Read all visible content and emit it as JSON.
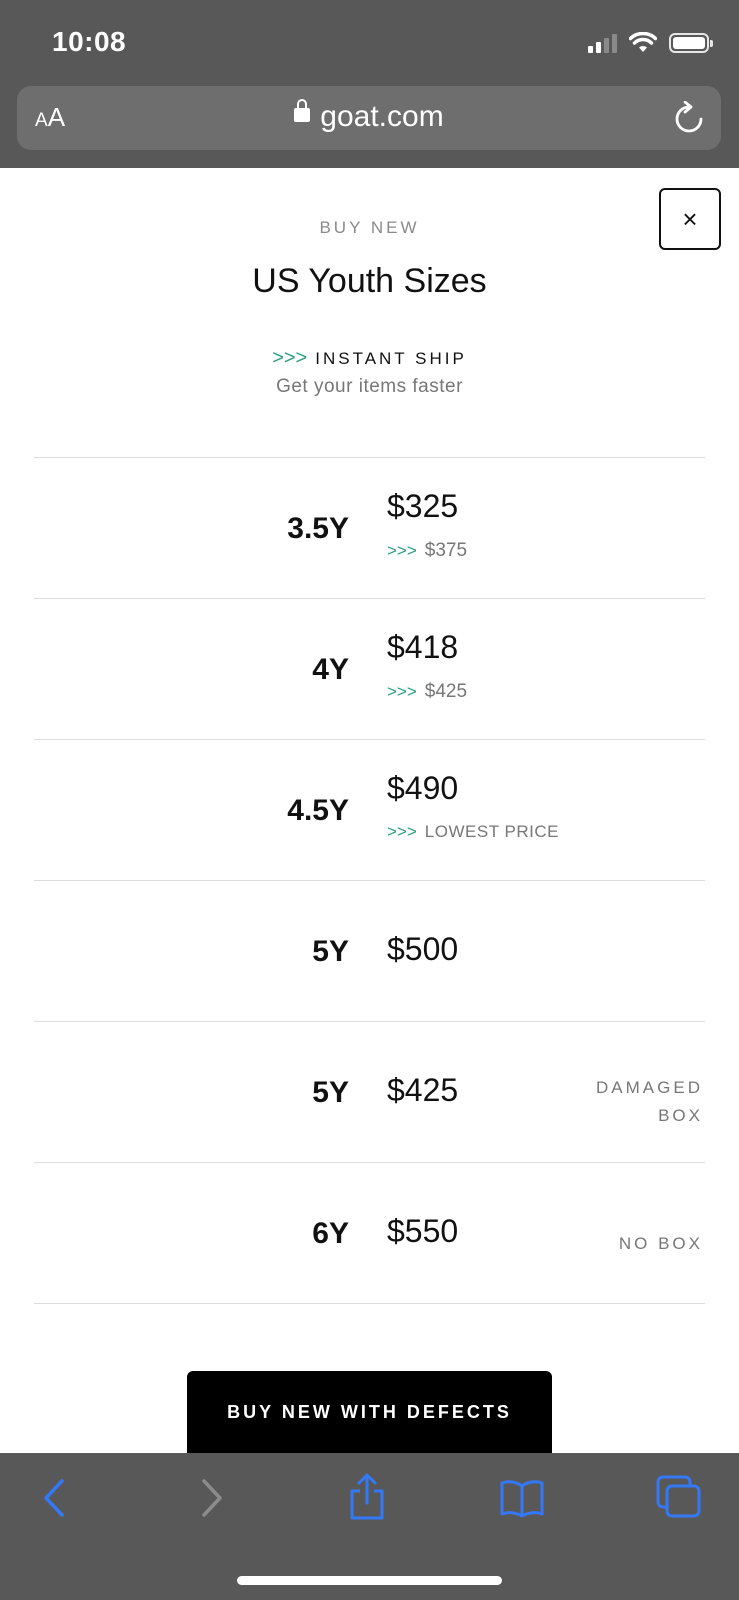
{
  "status_bar": {
    "time": "10:08"
  },
  "browser": {
    "text_size_small": "A",
    "text_size_large": "A",
    "url": "goat.com"
  },
  "modal": {
    "overline": "BUY NEW",
    "title": "US Youth Sizes",
    "instant_ship": {
      "chevrons": ">>>",
      "label": "INSTANT SHIP",
      "subtitle": "Get your items faster"
    },
    "close_label": "×"
  },
  "sizes": [
    {
      "size": "3.5Y",
      "price": "$325",
      "instant_price": "$375",
      "condition": ""
    },
    {
      "size": "4Y",
      "price": "$418",
      "instant_price": "$425",
      "condition": ""
    },
    {
      "size": "4.5Y",
      "price": "$490",
      "instant_price": "LOWEST PRICE",
      "condition": ""
    },
    {
      "size": "5Y",
      "price": "$500",
      "instant_price": "",
      "condition": ""
    },
    {
      "size": "5Y",
      "price": "$425",
      "instant_price": "",
      "condition_line1": "DAMAGED",
      "condition_line2": "BOX"
    },
    {
      "size": "6Y",
      "price": "$550",
      "instant_price": "",
      "condition": "NO BOX"
    }
  ],
  "defects_button": "BUY NEW WITH DEFECTS",
  "colors": {
    "accent_green": "#2a9d7c",
    "safari_chrome": "#585858",
    "safari_blue": "#3478f6"
  },
  "toolbar_icons": [
    "back-icon",
    "forward-icon",
    "share-icon",
    "bookmarks-icon",
    "tabs-icon"
  ]
}
